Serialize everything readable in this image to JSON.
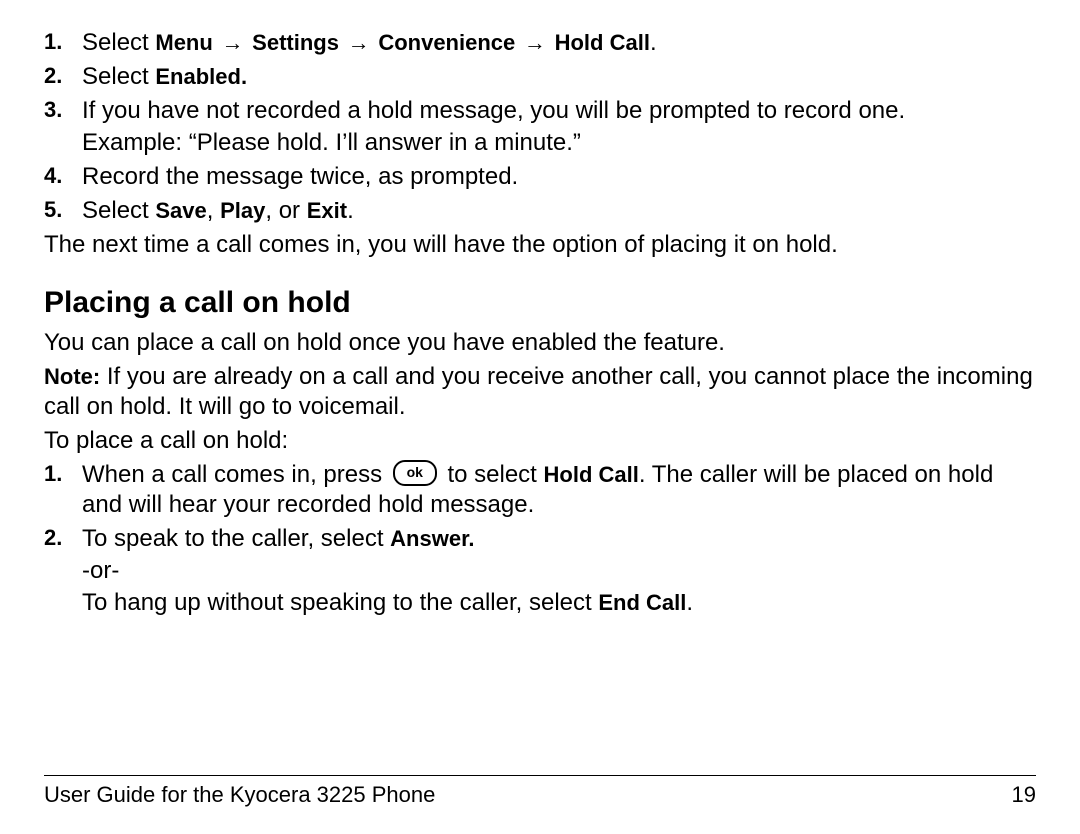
{
  "steps1": {
    "items": [
      {
        "num": "1.",
        "pre": "Select ",
        "path": [
          "Menu",
          "Settings",
          "Convenience",
          "Hold Call"
        ],
        "post": "."
      },
      {
        "num": "2.",
        "pre": "Select ",
        "bold": "Enabled."
      },
      {
        "num": "3.",
        "text": "If you have not recorded a hold message, you will be prompted to record one.",
        "example": "Example: “Please hold. I’ll answer in a minute.”"
      },
      {
        "num": "4.",
        "text": "Record the message twice, as prompted."
      },
      {
        "num": "5.",
        "pre": "Select ",
        "b1": "Save",
        "sep1": ", ",
        "b2": "Play",
        "sep2": ", or ",
        "b3": "Exit",
        "post": "."
      }
    ],
    "after": "The next time a call comes in, you will have the option of placing it on hold."
  },
  "section2": {
    "heading": "Placing a call on hold",
    "intro": "You can place a call on hold once you have enabled the feature.",
    "note_label": "Note:",
    "note_body": " If you are already on a call and you receive another call, you cannot place the incoming call on hold. It will go to voicemail.",
    "lead": "To place a call on hold:"
  },
  "steps2": {
    "items": [
      {
        "num": "1.",
        "pre": "When a call comes in, press ",
        "mid": " to select ",
        "bold": "Hold Call",
        "post": ". The caller will be placed on hold and will hear your recorded hold message."
      },
      {
        "num": "2.",
        "pre": "To speak to the caller, select ",
        "bold": "Answer.",
        "or": "-or-",
        "alt_pre": "To hang up without speaking to the caller, select ",
        "alt_bold": "End Call",
        "alt_post": "."
      }
    ]
  },
  "arrow_glyph": "→",
  "footer": {
    "left": "User Guide for the Kyocera 3225 Phone",
    "right": "19"
  }
}
